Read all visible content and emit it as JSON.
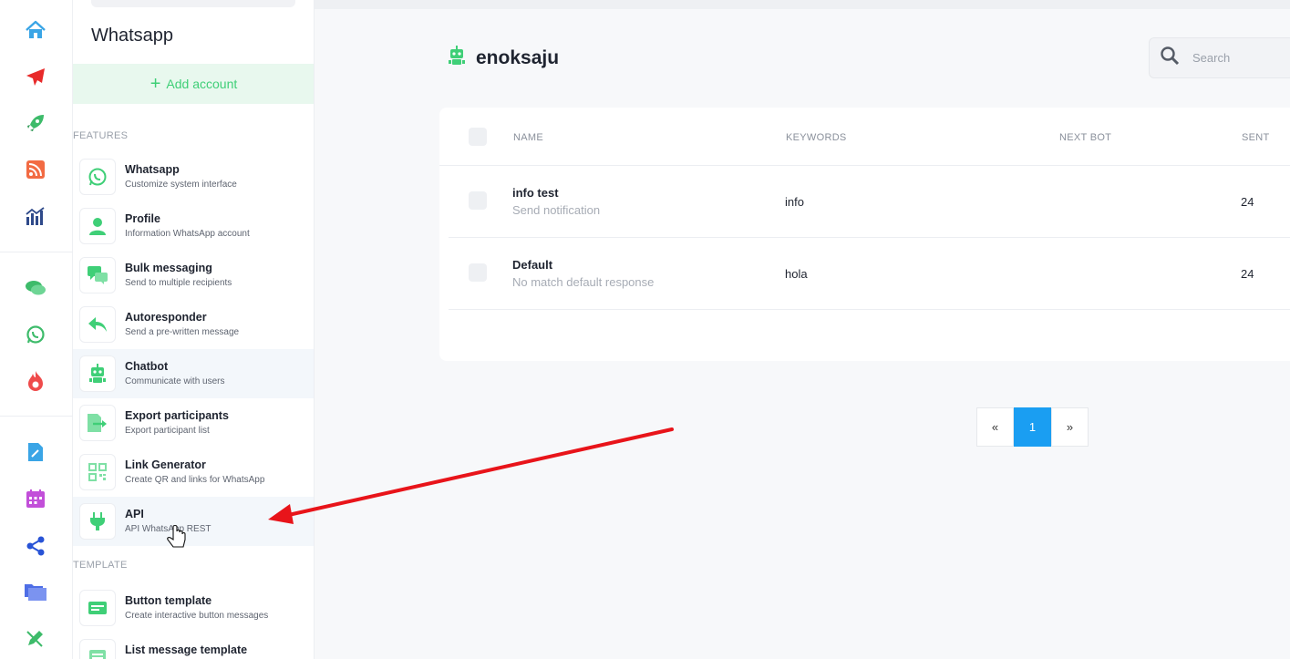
{
  "rail": {
    "icons": [
      "home-icon",
      "send-icon",
      "rocket-icon",
      "rss-icon",
      "analytics-icon",
      "chat-icon",
      "whatsapp-icon",
      "fire-icon",
      "edit-file-icon",
      "calendar-icon",
      "share-icon",
      "folder-icon",
      "pen-icon"
    ]
  },
  "sidebar": {
    "title": "Whatsapp",
    "add_account": "Add account",
    "features_label": "FEATURES",
    "template_label": "TEMPLATE",
    "items": [
      {
        "title": "Whatsapp",
        "sub": "Customize system interface",
        "icon": "whatsapp-icon"
      },
      {
        "title": "Profile",
        "sub": "Information WhatsApp account",
        "icon": "user-icon"
      },
      {
        "title": "Bulk messaging",
        "sub": "Send to multiple recipients",
        "icon": "chat-bubbles-icon"
      },
      {
        "title": "Autoresponder",
        "sub": "Send a pre-written message",
        "icon": "reply-icon"
      },
      {
        "title": "Chatbot",
        "sub": "Communicate with users",
        "icon": "robot-icon"
      },
      {
        "title": "Export participants",
        "sub": "Export participant list",
        "icon": "export-icon"
      },
      {
        "title": "Link Generator",
        "sub": "Create QR and links for WhatsApp",
        "icon": "qr-code-icon"
      },
      {
        "title": "API",
        "sub": "API WhatsApp REST",
        "icon": "plug-icon"
      }
    ],
    "template_items": [
      {
        "title": "Button template",
        "sub": "Create interactive button messages",
        "icon": "button-template-icon"
      },
      {
        "title": "List message template",
        "sub": "",
        "icon": "list-template-icon"
      }
    ]
  },
  "header": {
    "title": "enoksaju",
    "search_placeholder": "Search"
  },
  "table": {
    "columns": [
      "NAME",
      "KEYWORDS",
      "NEXT BOT",
      "SENT"
    ],
    "rows": [
      {
        "name": "info test",
        "desc": "Send notification",
        "keywords": "info",
        "next_bot": "",
        "sent": "24"
      },
      {
        "name": "Default",
        "desc": "No match default response",
        "keywords": "hola",
        "next_bot": "",
        "sent": "24"
      }
    ]
  },
  "pagination": {
    "prev": "«",
    "current": "1",
    "next": "»"
  },
  "colors": {
    "accent_green": "#3fcf77",
    "pagination_active": "#1a9ef2",
    "annotation_arrow": "#e8141a"
  }
}
